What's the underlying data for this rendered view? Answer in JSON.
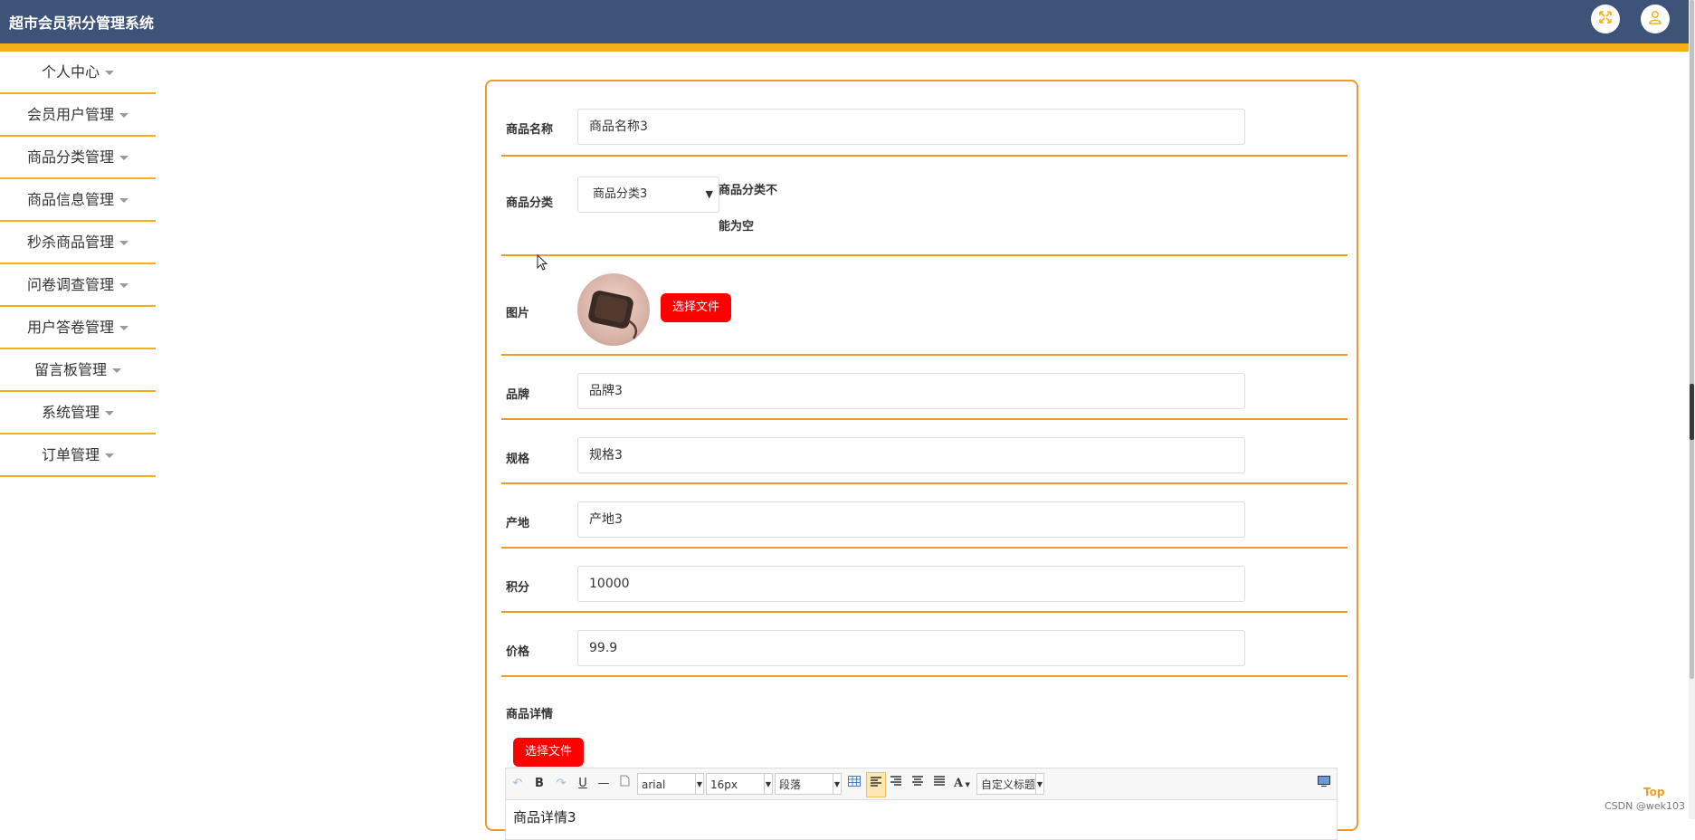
{
  "app": {
    "title": "超市会员积分管理系统"
  },
  "header": {
    "fullscreen_icon": "fullscreen-icon",
    "user_icon": "user-icon",
    "accent_color": "#f5b017",
    "bar_color": "#3e5378"
  },
  "sidebar": {
    "items": [
      {
        "label": "个人中心"
      },
      {
        "label": "会员用户管理"
      },
      {
        "label": "商品分类管理"
      },
      {
        "label": "商品信息管理"
      },
      {
        "label": "秒杀商品管理"
      },
      {
        "label": "问卷调查管理"
      },
      {
        "label": "用户答卷管理"
      },
      {
        "label": "留言板管理"
      },
      {
        "label": "系统管理"
      },
      {
        "label": "订单管理"
      }
    ]
  },
  "form": {
    "name": {
      "label": "商品名称",
      "value": "商品名称3"
    },
    "category": {
      "label": "商品分类",
      "value": "商品分类3",
      "error": "商品分类不能为空"
    },
    "image": {
      "label": "图片",
      "button": "选择文件"
    },
    "brand": {
      "label": "品牌",
      "value": "品牌3"
    },
    "spec": {
      "label": "规格",
      "value": "规格3"
    },
    "origin": {
      "label": "产地",
      "value": "产地3"
    },
    "points": {
      "label": "积分",
      "value": "10000"
    },
    "price": {
      "label": "价格",
      "value": "99.9"
    },
    "detail": {
      "label": "商品详情",
      "button": "选择文件",
      "content": "商品详情3"
    }
  },
  "editor_toolbar": {
    "undo": "↶",
    "bold": "B",
    "redo": "↷",
    "underline": "U",
    "hr": "—",
    "font_family": "arial",
    "font_size": "16px",
    "paragraph": "段落",
    "text_color": "A",
    "custom_title": "自定义标题"
  },
  "footer": {
    "top_link": "Top",
    "watermark": "CSDN @wek103"
  }
}
